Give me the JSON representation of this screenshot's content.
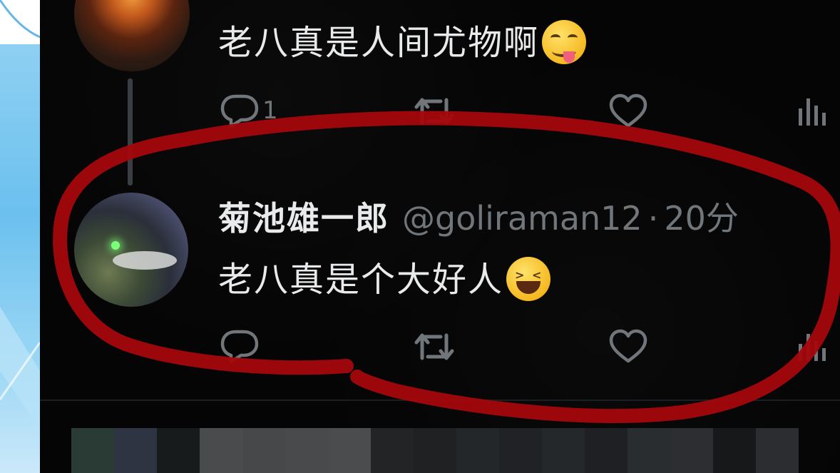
{
  "colors": {
    "background": "#050505",
    "text_primary": "#e9eaeb",
    "text_secondary": "#71767b",
    "annotation_red": "#a4070d",
    "side_panel_blue": "#6bc0ee"
  },
  "tweets": [
    {
      "text": "老八真是人间尤物啊",
      "emoji": "yum-emoji",
      "actions": {
        "reply_icon": "reply-icon",
        "reply_count": "1",
        "retweet_icon": "retweet-icon",
        "like_icon": "heart-icon",
        "views_icon": "views-icon"
      }
    },
    {
      "display_name": "菊池雄一郎",
      "handle": "@goliraman12",
      "separator": "·",
      "time": "20分",
      "text": "老八真是个大好人",
      "emoji": "laughing-emoji",
      "actions": {
        "reply_icon": "reply-icon",
        "retweet_icon": "retweet-icon",
        "like_icon": "heart-icon",
        "views_icon": "views-icon"
      }
    }
  ],
  "pixel_strip_colors": [
    "#2a3a35",
    "#2e3442",
    "#181b1c",
    "#4a4b4c",
    "#474849",
    "#494a4b",
    "#4b4c4d",
    "#222426",
    "#1f2123",
    "#24272a",
    "#202225",
    "#25282b",
    "#1e2023",
    "#2a2d30",
    "#2c2e31",
    "#16181a",
    "#2b2d30"
  ]
}
